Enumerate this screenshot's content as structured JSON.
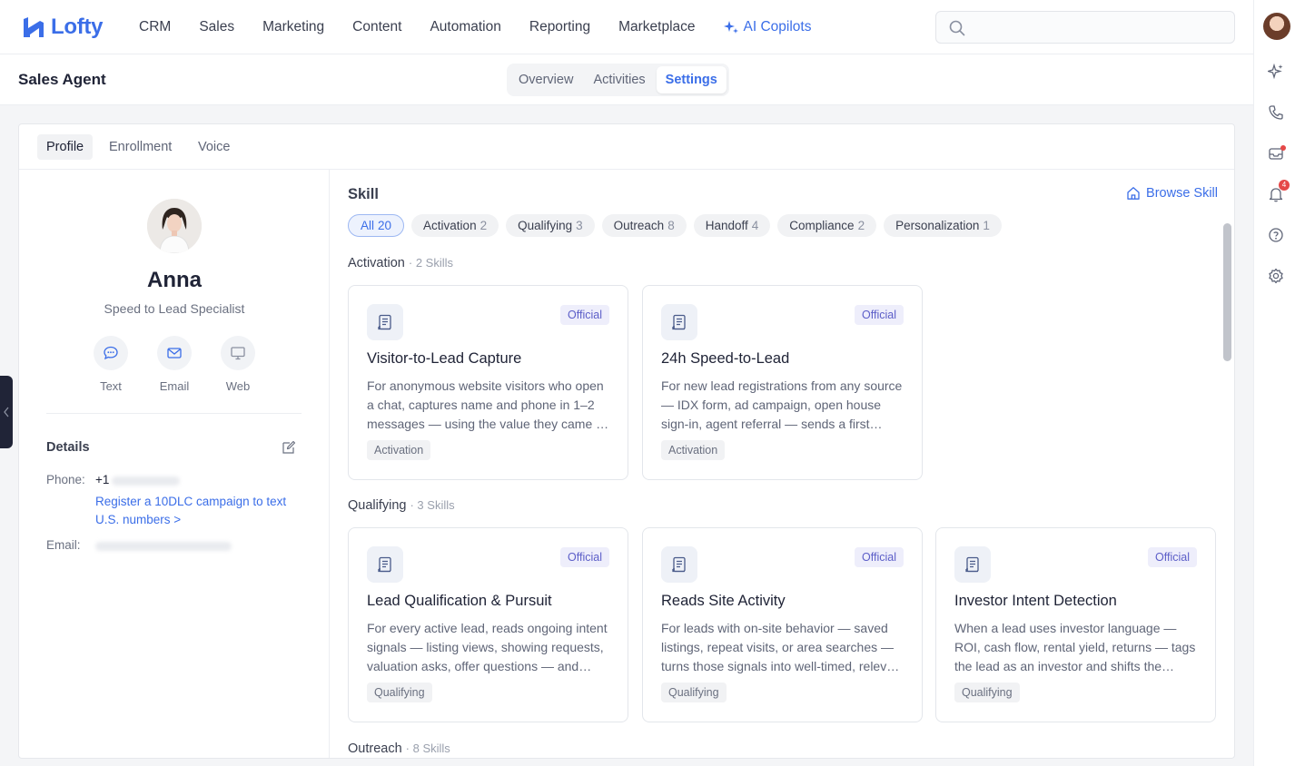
{
  "app": {
    "name": "Lofty"
  },
  "nav": {
    "items": [
      "CRM",
      "Sales",
      "Marketing",
      "Content",
      "Automation",
      "Reporting",
      "Marketplace"
    ],
    "ai_label": "AI Copilots"
  },
  "search": {
    "placeholder": ""
  },
  "rail": {
    "notification_count": "4"
  },
  "page": {
    "title": "Sales Agent",
    "tabs": [
      "Overview",
      "Activities",
      "Settings"
    ],
    "active_tab": "Settings"
  },
  "profile_tabs": [
    "Profile",
    "Enrollment",
    "Voice"
  ],
  "agent": {
    "name": "Anna",
    "role": "Speed to Lead Specialist",
    "channels": [
      "Text",
      "Email",
      "Web"
    ]
  },
  "details": {
    "title": "Details",
    "phone_label": "Phone:",
    "phone_prefix": "+1",
    "register_link": "Register a 10DLC campaign to text U.S. numbers >",
    "email_label": "Email:"
  },
  "skills": {
    "title": "Skill",
    "browse_label": "Browse Skill",
    "filters": [
      {
        "label": "All",
        "count": "20",
        "active": true
      },
      {
        "label": "Activation",
        "count": "2"
      },
      {
        "label": "Qualifying",
        "count": "3"
      },
      {
        "label": "Outreach",
        "count": "8"
      },
      {
        "label": "Handoff",
        "count": "4"
      },
      {
        "label": "Compliance",
        "count": "2"
      },
      {
        "label": "Personalization",
        "count": "1"
      }
    ],
    "sections": [
      {
        "name": "Activation",
        "count_label": "· 2 Skills",
        "cards": [
          {
            "title": "Visitor-to-Lead Capture",
            "badge": "Official",
            "desc": "For anonymous website visitors who open a chat, captures name and phone in 1–2 messages — using the value they came for to earn the contact details.",
            "tag": "Activation"
          },
          {
            "title": "24h Speed-to-Lead",
            "badge": "Official",
            "desc": "For new lead registrations from any source — IDX form, ad campaign, open house sign-in, agent referral — sends a first personalized touch within minutes.",
            "tag": "Activation"
          }
        ]
      },
      {
        "name": "Qualifying",
        "count_label": "· 3 Skills",
        "cards": [
          {
            "title": "Lead Qualification & Pursuit",
            "badge": "Official",
            "desc": "For every active lead, reads ongoing intent signals — listing views, showing requests, valuation asks, offer questions — and keeps qualifying.",
            "tag": "Qualifying"
          },
          {
            "title": "Reads Site Activity",
            "badge": "Official",
            "desc": "For leads with on-site behavior — saved listings, repeat visits, or area searches — turns those signals into well-timed, relevant follow-ups.",
            "tag": "Qualifying"
          },
          {
            "title": "Investor Intent Detection",
            "badge": "Official",
            "desc": "When a lead uses investor language — ROI, cash flow, rental yield, returns — tags the lead as an investor and shifts the conversation accordingly.",
            "tag": "Qualifying"
          }
        ]
      },
      {
        "name": "Outreach",
        "count_label": "· 8 Skills",
        "cards": []
      }
    ]
  },
  "colors": {
    "accent": "#3b6ee8",
    "official_badge": "#5c5ec8",
    "dark": "#202437"
  }
}
